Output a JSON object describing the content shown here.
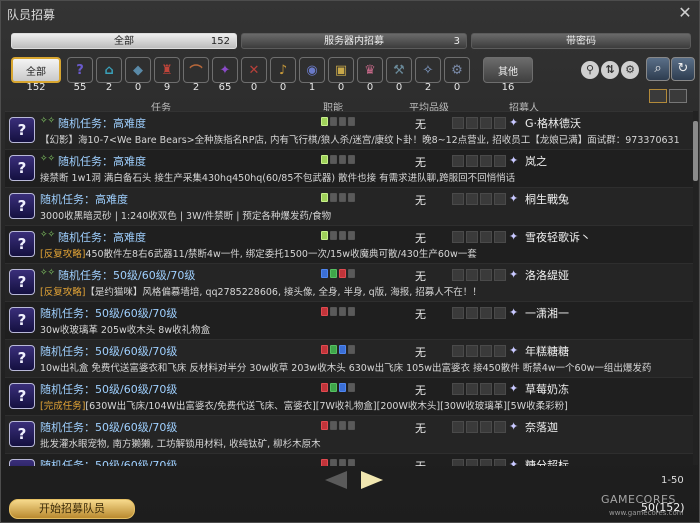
{
  "window": {
    "title": "队员招募",
    "close_icon": "✕"
  },
  "tabs": [
    {
      "label": "全部",
      "count": "152"
    },
    {
      "label": "服务器内招募",
      "count": "3"
    },
    {
      "label": "带密码",
      "count": ""
    }
  ],
  "filters": {
    "all": {
      "label": "全部",
      "count": "152"
    },
    "categories": [
      {
        "icon": "?",
        "count": "55",
        "name": "roulette"
      },
      {
        "icon": "⌂",
        "count": "2",
        "name": "dungeon"
      },
      {
        "icon": "◆",
        "count": "0",
        "name": "guildhest"
      },
      {
        "icon": "♜",
        "count": "9",
        "name": "trial"
      },
      {
        "icon": "⌒",
        "count": "2",
        "name": "raid"
      },
      {
        "icon": "✦",
        "count": "65",
        "name": "high-end"
      },
      {
        "icon": "✕",
        "count": "0",
        "name": "pvp"
      },
      {
        "icon": "♪",
        "count": "0",
        "name": "quest"
      },
      {
        "icon": "◉",
        "count": "1",
        "name": "fate"
      },
      {
        "icon": "▣",
        "count": "0",
        "name": "treasure-hunt"
      },
      {
        "icon": "♛",
        "count": "0",
        "name": "hunt"
      },
      {
        "icon": "⚒",
        "count": "0",
        "name": "gathering"
      },
      {
        "icon": "✧",
        "count": "2",
        "name": "deep-dungeon"
      },
      {
        "icon": "⚙",
        "count": "0",
        "name": "adventuring-forays"
      }
    ],
    "other": {
      "label": "其他",
      "count": "16"
    }
  },
  "columns": {
    "duty": "任务",
    "role": "职能",
    "ilvl": "平均品级",
    "recruiter": "招募人"
  },
  "listings": [
    {
      "mentor": true,
      "duty": "随机任务：高难度",
      "tag": "",
      "desc": "【幻影】海10-7<We Bare Bears>全种族指名RP店, 内有飞行棋/狼人杀/迷宫/康纹卜卦！晚8~12点营业, 招收员工【龙娘已满】面试群：973370631",
      "roles": [
        "check",
        "n",
        "n",
        "n"
      ],
      "ilvl": "无",
      "recruiter": "G·格林德沃"
    },
    {
      "mentor": true,
      "duty": "随机任务：高难度",
      "tag": "",
      "desc": "接禁断 1w1洞 满白备石头 接生产采集430hq450hq(60/85不包武器) 散件也接 有需求进队聊,跨服回不回悄悄话",
      "roles": [
        "check",
        "n",
        "n",
        "n"
      ],
      "ilvl": "无",
      "recruiter": "岚之"
    },
    {
      "mentor": false,
      "duty": "随机任务：高难度",
      "tag": "",
      "desc": "3000收黑暗灵砂 | 1:240收双色 | 3W/件禁断 | 预定各种爆发药/食物",
      "roles": [
        "check",
        "n",
        "n",
        "n"
      ],
      "ilvl": "无",
      "recruiter": "桐生戰兔"
    },
    {
      "mentor": true,
      "duty": "随机任务：高难度",
      "tag": "[反复攻略]",
      "desc": "450散件左8右6武器11/禁断4w一件, 绑定委托1500一次/15w收魔典可散/430生产60w一套",
      "roles": [
        "check",
        "n",
        "n",
        "n"
      ],
      "ilvl": "无",
      "recruiter": "雪夜轻歌诉丶"
    },
    {
      "mentor": true,
      "duty": "随机任务：50级/60级/70级",
      "tag": "[反复攻略]",
      "desc": "【是约猫咪】风格偏慕墙培, qq2785228606, 接头像, 全身, 半身, q版, 海报, 招募人不在！！",
      "roles": [
        "tank",
        "heal",
        "dps",
        "n"
      ],
      "ilvl": "无",
      "recruiter": "洛洛缇娅"
    },
    {
      "mentor": false,
      "duty": "随机任务：50级/60级/70级",
      "tag": "",
      "desc": "30w收玻璃革 205w收木头 8w收礼物盒",
      "roles": [
        "dps",
        "n",
        "n",
        "n"
      ],
      "ilvl": "无",
      "recruiter": "一潇湘一"
    },
    {
      "mentor": false,
      "duty": "随机任务：50级/60级/70级",
      "tag": "",
      "desc": "10w出礼盒 免费代送富婆衣和飞床 反材料对半分 30w收草 203w收木头 630w出飞床 105w出富婆衣 接450散件 断禁4w一个60w一组出爆发药",
      "roles": [
        "dps",
        "heal",
        "tank",
        "n"
      ],
      "ilvl": "无",
      "recruiter": "年糕糖糖"
    },
    {
      "mentor": false,
      "duty": "随机任务：50级/60级/70级",
      "tag": "[完成任务]",
      "desc": "[630W出飞床/104W出富婆衣/免费代送飞床、富婆衣][7W收礼物盒][200W收木头][30W收玻璃革][5W收柔彩粉]",
      "roles": [
        "dps",
        "heal",
        "tank",
        "n"
      ],
      "ilvl": "无",
      "recruiter": "草莓奶冻"
    },
    {
      "mentor": false,
      "duty": "随机任务：50级/60级/70级",
      "tag": "",
      "desc": "批发灌水眼宠物, 南方獭獭, 工坊解锁用材料, 收纯钛矿, 柳杉木原木",
      "roles": [
        "dps",
        "n",
        "n",
        "n"
      ],
      "ilvl": "无",
      "recruiter": "奈落迦"
    },
    {
      "mentor": false,
      "duty": "随机任务：50级/60级/70级",
      "tag": "",
      "desc": "",
      "roles": [
        "dps",
        "n",
        "n",
        "n"
      ],
      "ilvl": "无",
      "recruiter": "糖分超标"
    }
  ],
  "footer": {
    "range": "1-50",
    "start_button": "开始招募队员",
    "total": "50(152)"
  },
  "watermark": {
    "brand": "GAMECORES",
    "sub": "www.gamecores.com"
  }
}
